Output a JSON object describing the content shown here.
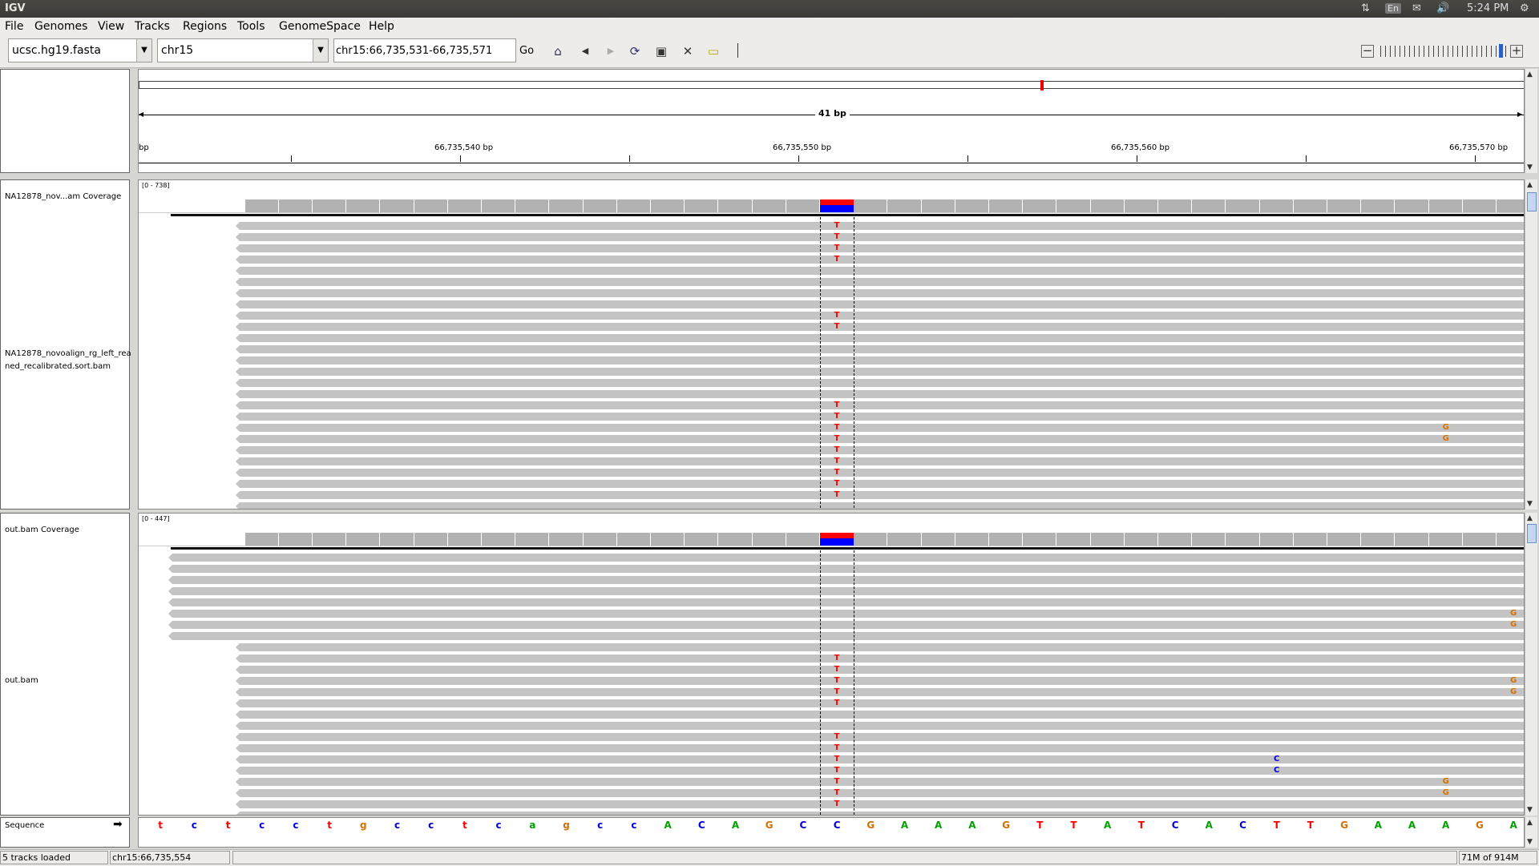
{
  "window": {
    "title": "IGV"
  },
  "os_bar": {
    "keyboard": "En",
    "clock": "5:24 PM"
  },
  "menu": [
    "File",
    "Genomes",
    "View",
    "Tracks",
    "Regions",
    "Tools",
    "GenomeSpace",
    "Help"
  ],
  "toolbar": {
    "genome": "ucsc.hg19.fasta",
    "chromosome": "chr15",
    "locus": "chr15:66,735,531-66,735,571",
    "go_label": "Go"
  },
  "ruler": {
    "span_label": "41 bp",
    "start_label": "bp",
    "tick_labels": [
      "66,735,540 bp",
      "66,735,550 bp",
      "66,735,560 bp",
      "66,735,570 bp"
    ]
  },
  "tracks": {
    "coverage1_name": "NA12878_nov...am Coverage",
    "coverage1_range": "[0 - 738]",
    "bam1_name_line1": "NA12878_novoalign_rg_left_rea",
    "bam1_name_line2": "ned_recalibrated.sort.bam",
    "coverage2_name": "out.bam Coverage",
    "coverage2_range": "[0 - 447]",
    "bam2_name": "out.bam",
    "sequence_name": "Sequence"
  },
  "sequence": [
    "t",
    "c",
    "t",
    "c",
    "c",
    "t",
    "g",
    "c",
    "c",
    "t",
    "c",
    "a",
    "g",
    "c",
    "c",
    "A",
    "C",
    "A",
    "G",
    "C",
    "C",
    "G",
    "A",
    "A",
    "A",
    "G",
    "T",
    "T",
    "A",
    "T",
    "C",
    "A",
    "C",
    "T",
    "T",
    "G",
    "A",
    "A",
    "A",
    "G",
    "A"
  ],
  "mismatches": {
    "bam1": [
      {
        "row": 1,
        "base": "T",
        "col": 20
      },
      {
        "row": 2,
        "base": "T",
        "col": 20
      },
      {
        "row": 3,
        "base": "T",
        "col": 20
      },
      {
        "row": 4,
        "base": "T",
        "col": 20
      },
      {
        "row": 9,
        "base": "T",
        "col": 20
      },
      {
        "row": 10,
        "base": "T",
        "col": 20
      },
      {
        "row": 17,
        "base": "T",
        "col": 20
      },
      {
        "row": 18,
        "base": "T",
        "col": 20
      },
      {
        "row": 19,
        "base": "T",
        "col": 20
      },
      {
        "row": 20,
        "base": "T",
        "col": 20
      },
      {
        "row": 21,
        "base": "T",
        "col": 20
      },
      {
        "row": 22,
        "base": "T",
        "col": 20
      },
      {
        "row": 23,
        "base": "T",
        "col": 20
      },
      {
        "row": 24,
        "base": "T",
        "col": 20
      },
      {
        "row": 25,
        "base": "T",
        "col": 20
      },
      {
        "row": 19,
        "base": "G",
        "col": 38
      },
      {
        "row": 20,
        "base": "G",
        "col": 38
      }
    ],
    "bam2": [
      {
        "row": 6,
        "base": "G",
        "col": 40
      },
      {
        "row": 7,
        "base": "G",
        "col": 40
      },
      {
        "row": 10,
        "base": "T",
        "col": 20
      },
      {
        "row": 11,
        "base": "T",
        "col": 20
      },
      {
        "row": 12,
        "base": "T",
        "col": 20
      },
      {
        "row": 13,
        "base": "T",
        "col": 20
      },
      {
        "row": 14,
        "base": "T",
        "col": 20
      },
      {
        "row": 12,
        "base": "G",
        "col": 40
      },
      {
        "row": 13,
        "base": "G",
        "col": 40
      },
      {
        "row": 17,
        "base": "T",
        "col": 20
      },
      {
        "row": 18,
        "base": "T",
        "col": 20
      },
      {
        "row": 19,
        "base": "T",
        "col": 20
      },
      {
        "row": 20,
        "base": "T",
        "col": 20
      },
      {
        "row": 21,
        "base": "T",
        "col": 20
      },
      {
        "row": 22,
        "base": "T",
        "col": 20
      },
      {
        "row": 23,
        "base": "T",
        "col": 20
      },
      {
        "row": 19,
        "base": "C",
        "col": 33
      },
      {
        "row": 20,
        "base": "C",
        "col": 33
      },
      {
        "row": 21,
        "base": "G",
        "col": 38
      },
      {
        "row": 22,
        "base": "G",
        "col": 38
      }
    ]
  },
  "status": {
    "tracks_loaded": "5 tracks loaded",
    "position": "chr15:66,735,554",
    "memory": "71M of 914M"
  },
  "colors": {
    "A": "#00a000",
    "C": "#0000e0",
    "G": "#d17105",
    "T": "#ff0000",
    "alt_allele": "#ff0000",
    "ref_allele": "#0000ff"
  }
}
